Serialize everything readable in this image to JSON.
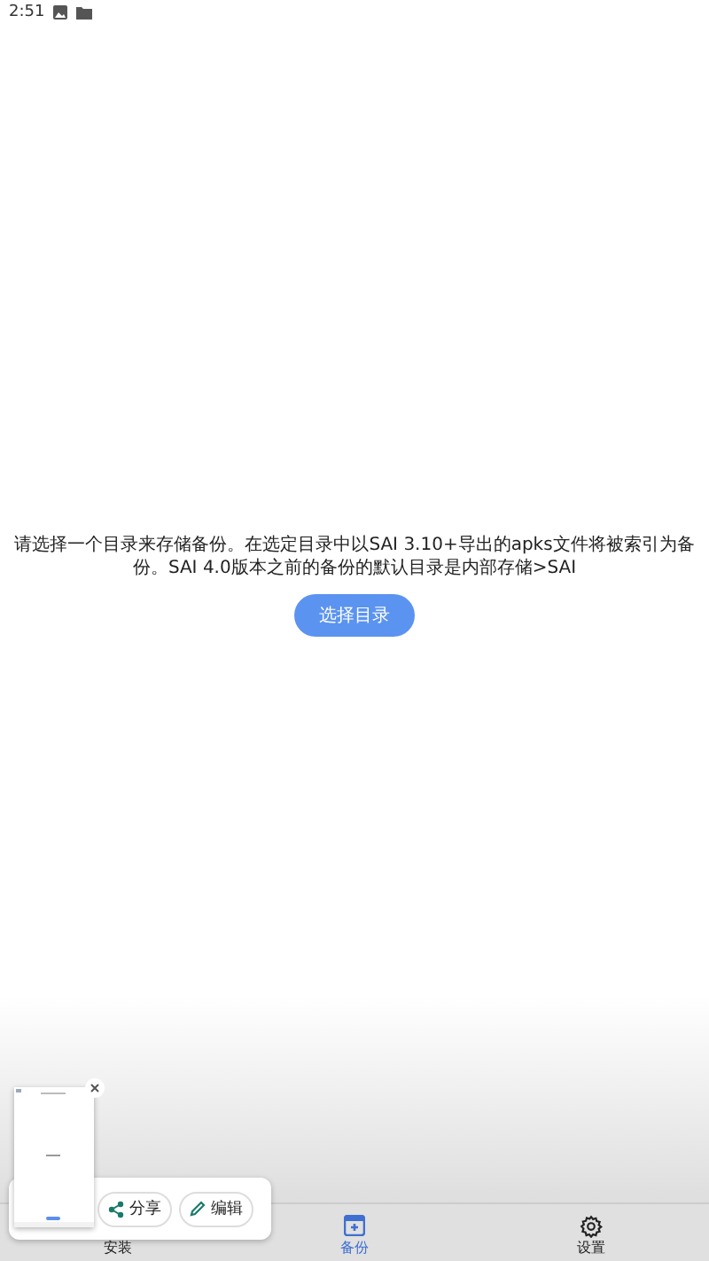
{
  "status_bar": {
    "time": "2:51"
  },
  "message": "请选择一个目录来存储备份。在选定目录中以SAI 3.10+导出的apks文件将被索引为备份。SAI 4.0版本之前的备份的默认目录是内部存储>SAI",
  "action_button": {
    "label": "选择目录"
  },
  "bottom_nav": [
    {
      "label": "安装",
      "selected": false,
      "kind": "install"
    },
    {
      "label": "备份",
      "selected": true,
      "kind": "backup"
    },
    {
      "label": "设置",
      "selected": false,
      "kind": "settings"
    }
  ],
  "screenshot_preview": {
    "actions": [
      {
        "label": "分享",
        "kind": "share"
      },
      {
        "label": "编辑",
        "kind": "edit"
      }
    ]
  }
}
